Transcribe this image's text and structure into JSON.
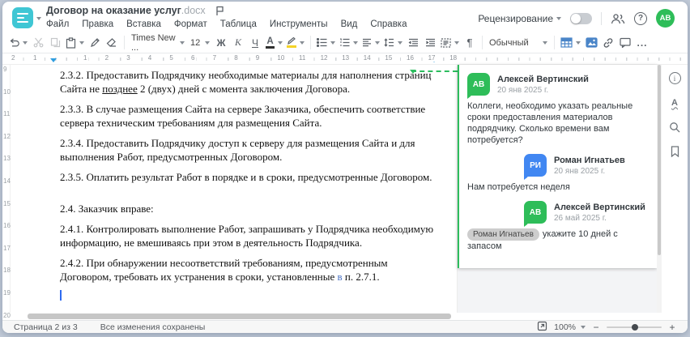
{
  "header": {
    "title": "Договор на оказание услуг",
    "title_ext": ".docx",
    "menu": [
      "Файл",
      "Правка",
      "Вставка",
      "Формат",
      "Таблица",
      "Инструменты",
      "Вид",
      "Справка"
    ],
    "review_label": "Рецензирование",
    "user_initials": "АВ"
  },
  "toolbar": {
    "font_name": "Times New ...",
    "font_size": "12",
    "bold_label": "Ж",
    "italic_label": "К",
    "underline_label": "Ч",
    "font_color_label": "А",
    "pilcrow": "¶",
    "style_name": "Обычный",
    "more": "..."
  },
  "ruler": {
    "left_numbers": [
      "2",
      "1"
    ],
    "numbers": [
      "1",
      "2",
      "3",
      "4",
      "5",
      "6",
      "7",
      "8",
      "9",
      "10",
      "11",
      "12",
      "13",
      "14",
      "15",
      "16",
      "17",
      "18"
    ],
    "vertical_numbers": [
      "9",
      "10",
      "11",
      "12",
      "13",
      "14",
      "15",
      "16",
      "17",
      "18",
      "19",
      "20"
    ]
  },
  "document": {
    "paragraphs": [
      {
        "segments": [
          {
            "text": "2.3.2. Предоставить Подрядчику необходимые материалы для наполнения страниц Сайта не "
          },
          {
            "text": "позднее",
            "underline": true
          },
          {
            "text": " 2 (двух) дней с момента заключения Договора."
          }
        ]
      },
      {
        "segments": [
          {
            "text": "2.3.3. В случае размещения Сайта на сервере Заказчика, обеспечить соответствие сервера техническим требованиям для размещения Сайта."
          }
        ]
      },
      {
        "segments": [
          {
            "text": "2.3.4. Предоставить Подрядчику доступ к серверу для размещения Сайта и для выполнения Работ, предусмотренных Договором."
          }
        ]
      },
      {
        "segments": [
          {
            "text": "2.3.5. Оплатить результат Работ в порядке и в сроки, предусмотренные Договором."
          }
        ]
      },
      {
        "big_gap": true,
        "segments": [
          {
            "text": "2.4. Заказчик вправе:"
          }
        ]
      },
      {
        "segments": [
          {
            "text": "2.4.1. Контролировать выполнение Работ, запрашивать у Подрядчика необходимую информацию, не вмешиваясь при этом в деятельность Подрядчика."
          }
        ]
      },
      {
        "segments": [
          {
            "text": "2.4.2. При обнаружении несоответствий требованиям, предусмотренным Договором, требовать их устранения в сроки, установленные "
          },
          {
            "text": "в",
            "link": true
          },
          {
            "text": " п. 2.7.1."
          }
        ]
      }
    ]
  },
  "comments": {
    "entries": [
      {
        "initials": "АВ",
        "avatar_color": "#2ebd59",
        "name": "Алексей Вертинский",
        "date": "20 янв 2025 г.",
        "text": "Коллеги, необходимо указать реальные сроки предоставления материалов подрядчику. Сколько времени вам потребуется?",
        "reply": false
      },
      {
        "initials": "РИ",
        "avatar_color": "#4187f2",
        "name": "Роман Игнатьев",
        "date": "20 янв 2025 г.",
        "text": "Нам потребуется неделя",
        "reply": true
      },
      {
        "initials": "АВ",
        "avatar_color": "#2ebd59",
        "name": "Алексей Вертинский",
        "date": "26 май 2025 г.",
        "mention": "Роман Игнатьев",
        "text": "укажите 10 дней с запасом",
        "reply": true
      }
    ]
  },
  "statusbar": {
    "page_label": "Страница 2 из 3",
    "saved_label": "Все изменения сохранены",
    "zoom_value": "100%",
    "zoom_minus": "−",
    "zoom_plus": "+"
  },
  "colors": {
    "logo_teal": "#3fc6d4",
    "accent_blue": "#4a85c8",
    "comment_green": "#2dbd5e",
    "avatar_green": "#2ebd59",
    "avatar_blue": "#4187f2",
    "ruler_marker_blue": "#2f9ee0"
  }
}
